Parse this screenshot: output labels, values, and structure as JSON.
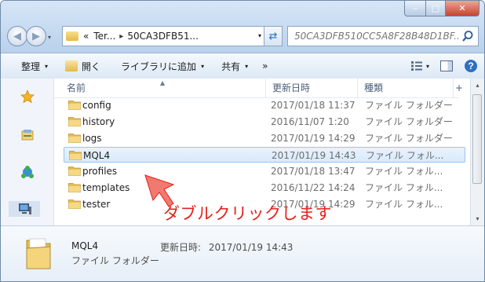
{
  "window": {
    "minimize_glyph": "‒",
    "maximize_glyph": "□",
    "close_glyph": "✕"
  },
  "address_bar": {
    "overflow_chevron": "«",
    "crumbs": [
      "Ter...",
      "50CA3DFB51..."
    ],
    "separator": "▸",
    "dropdown_glyph": "▾",
    "refresh_glyph": "⇄"
  },
  "search": {
    "placeholder": "50CA3DFB510CC5A8F28B48D1BF..."
  },
  "toolbar": {
    "organize_label": "整理",
    "open_label": "開く",
    "library_label": "ライブラリに追加",
    "share_label": "共有",
    "more_label": "»",
    "dropdown_glyph": "▾"
  },
  "columns": {
    "name": "名前",
    "modified": "更新日時",
    "type": "種類",
    "extra": "+"
  },
  "files": [
    {
      "name": "config",
      "date": "2017/01/18 11:37",
      "type": "ファイル フォルダー"
    },
    {
      "name": "history",
      "date": "2016/11/07 1:20",
      "type": "ファイル フォルダー"
    },
    {
      "name": "logs",
      "date": "2017/01/19 14:29",
      "type": "ファイル フォルダー"
    },
    {
      "name": "MQL4",
      "date": "2017/01/19 14:43",
      "type": "ファイル フォル...",
      "selected": true
    },
    {
      "name": "profiles",
      "date": "2017/01/18 13:47",
      "type": "ファイル フォル..."
    },
    {
      "name": "templates",
      "date": "2016/11/22 14:24",
      "type": "ファイル フォル..."
    },
    {
      "name": "tester",
      "date": "2017/01/19 14:29",
      "type": "ファイル フォル..."
    }
  ],
  "annotation": {
    "text": "ダブルクリックします",
    "color": "#e8201b"
  },
  "details": {
    "name": "MQL4",
    "modified_label": "更新日時:",
    "modified_value": "2017/01/19 14:43",
    "type": "ファイル フォルダー"
  },
  "scrollbar": {
    "up_glyph": "▴",
    "down_glyph": "▾"
  },
  "icons": [
    "star-icon",
    "libraries-icon",
    "network-icon",
    "computer-icon",
    "folder-icon",
    "search-icon",
    "help-icon",
    "view-icon"
  ]
}
